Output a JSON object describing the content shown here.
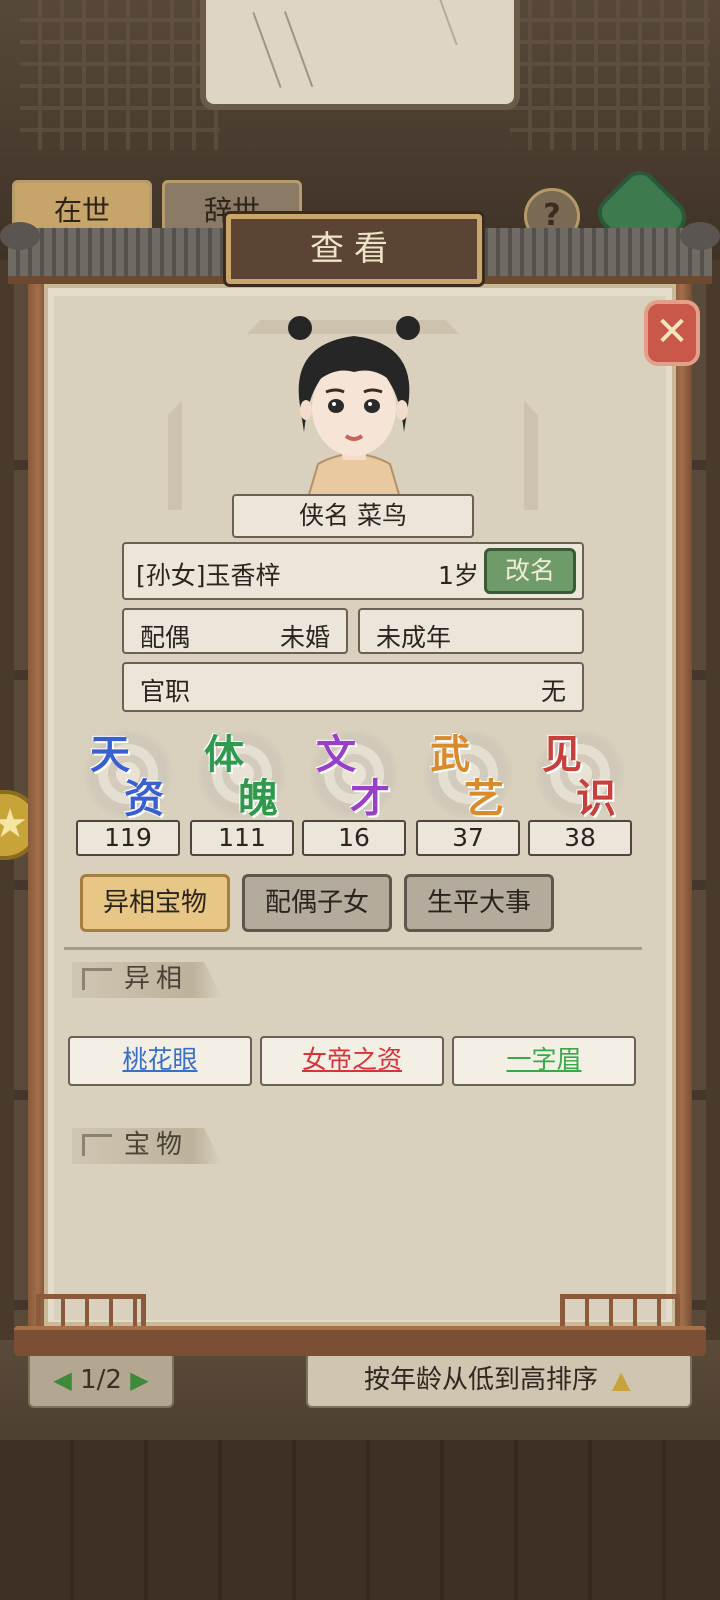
{
  "background": {
    "tabs": [
      "在世",
      "辞世"
    ],
    "help_glyph": "?",
    "pager": {
      "prev": "◀",
      "text": "1/2",
      "next": "▶"
    },
    "sort_label": "按年龄从低到高排序",
    "sort_icon": "▲"
  },
  "dialog": {
    "title": "查看",
    "close_glyph": "✕"
  },
  "profile": {
    "name_line": "侠名 菜鸟",
    "relation_name": "[孙女]玉香梓",
    "age": "1岁",
    "rename_button": "改名",
    "spouse_label": "配偶",
    "spouse_value": "未婚",
    "adult_status": "未成年",
    "office_label": "官职",
    "office_value": "无"
  },
  "stats": [
    {
      "c1": "天",
      "c2": "资",
      "value": "119",
      "color": "#3a5fcf"
    },
    {
      "c1": "体",
      "c2": "魄",
      "value": "111",
      "color": "#2f9a4c"
    },
    {
      "c1": "文",
      "c2": "才",
      "value": "16",
      "color": "#9a3fc8"
    },
    {
      "c1": "武",
      "c2": "艺",
      "value": "37",
      "color": "#d98a2a"
    },
    {
      "c1": "见",
      "c2": "识",
      "value": "38",
      "color": "#c8403a"
    }
  ],
  "tabs": [
    "异相宝物",
    "配偶子女",
    "生平大事"
  ],
  "sections": {
    "traits_title": "异相",
    "treasures_title": "宝物"
  },
  "traits": [
    {
      "label": "桃花眼",
      "color": "#3a6fc8"
    },
    {
      "label": "女帝之资",
      "color": "#d8323a"
    },
    {
      "label": "一字眉",
      "color": "#3aa84a"
    }
  ]
}
